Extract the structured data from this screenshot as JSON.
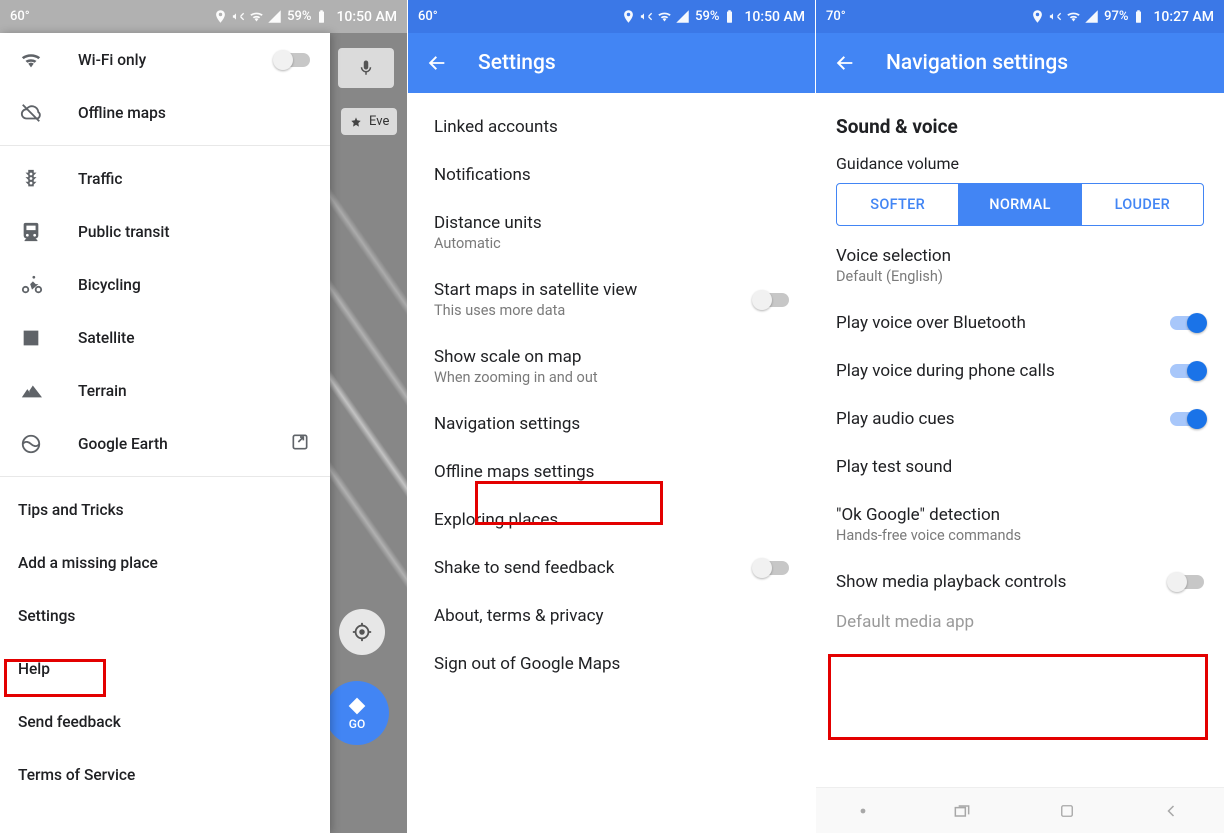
{
  "phone1": {
    "status": {
      "temp": "60°",
      "battery": "59%",
      "time": "10:50 AM"
    },
    "drawer": {
      "wifi_only": "Wi-Fi only",
      "offline_maps": "Offline maps",
      "traffic": "Traffic",
      "public_transit": "Public transit",
      "bicycling": "Bicycling",
      "satellite": "Satellite",
      "terrain": "Terrain",
      "google_earth": "Google Earth",
      "tips": "Tips and Tricks",
      "add_place": "Add a missing place",
      "settings": "Settings",
      "help": "Help",
      "feedback": "Send feedback",
      "tos": "Terms of Service"
    },
    "map": {
      "chip": "Eve",
      "go": "GO"
    }
  },
  "phone2": {
    "status": {
      "temp": "60°",
      "battery": "59%",
      "time": "10:50 AM"
    },
    "title": "Settings",
    "items": {
      "linked": "Linked accounts",
      "notifications": "Notifications",
      "distance": "Distance units",
      "distance_sub": "Automatic",
      "satellite": "Start maps in satellite view",
      "satellite_sub": "This uses more data",
      "scale": "Show scale on map",
      "scale_sub": "When zooming in and out",
      "nav": "Navigation settings",
      "offline": "Offline maps settings",
      "exploring": "Exploring places",
      "shake": "Shake to send feedback",
      "about": "About, terms & privacy",
      "signout": "Sign out of Google Maps"
    }
  },
  "phone3": {
    "status": {
      "temp": "70°",
      "battery": "97%",
      "time": "10:27 AM"
    },
    "title": "Navigation settings",
    "section": "Sound & voice",
    "guidance": "Guidance volume",
    "seg": {
      "softer": "SOFTER",
      "normal": "NORMAL",
      "louder": "LOUDER"
    },
    "voice_sel": "Voice selection",
    "voice_sel_sub": "Default (English)",
    "bt": "Play voice over Bluetooth",
    "calls": "Play voice during phone calls",
    "cues": "Play audio cues",
    "test": "Play test sound",
    "okg": "\"Ok Google\" detection",
    "okg_sub": "Hands-free voice commands",
    "media": "Show media playback controls",
    "media_app": "Default media app"
  }
}
